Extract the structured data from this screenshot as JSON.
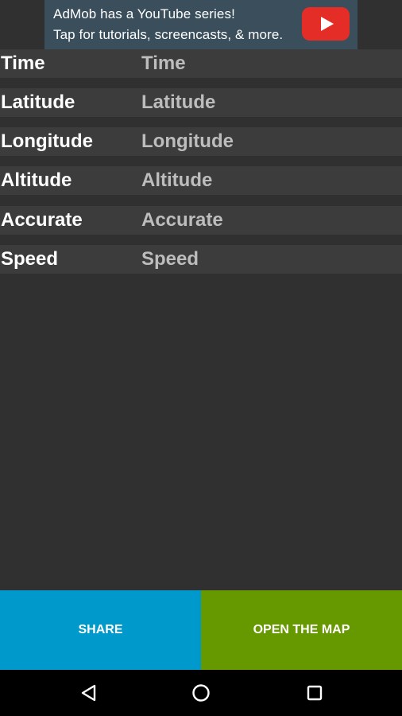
{
  "ad": {
    "line1": "AdMob has a YouTube series!",
    "line2": "Tap for tutorials, screencasts, & more.",
    "icon": "youtube-play-icon"
  },
  "fields": [
    {
      "label": "Time",
      "value": "Time"
    },
    {
      "label": "Latitude",
      "value": "Latitude"
    },
    {
      "label": "Longitude",
      "value": "Longitude"
    },
    {
      "label": "Altitude",
      "value": "Altitude"
    },
    {
      "label": "Accurate",
      "value": "Accurate"
    },
    {
      "label": "Speed",
      "value": "Speed"
    }
  ],
  "buttons": {
    "share": "SHARE",
    "open_map": "OPEN THE MAP"
  },
  "navbar": {
    "back_icon": "back-triangle-icon",
    "home_icon": "home-circle-icon",
    "recent_icon": "recent-apps-square-icon"
  },
  "colors": {
    "background": "#303030",
    "row_background": "#3c3c3c",
    "share_button": "#0099cc",
    "map_button": "#669900",
    "ad_background": "#3a4e5b",
    "youtube_red": "#e52d27"
  }
}
